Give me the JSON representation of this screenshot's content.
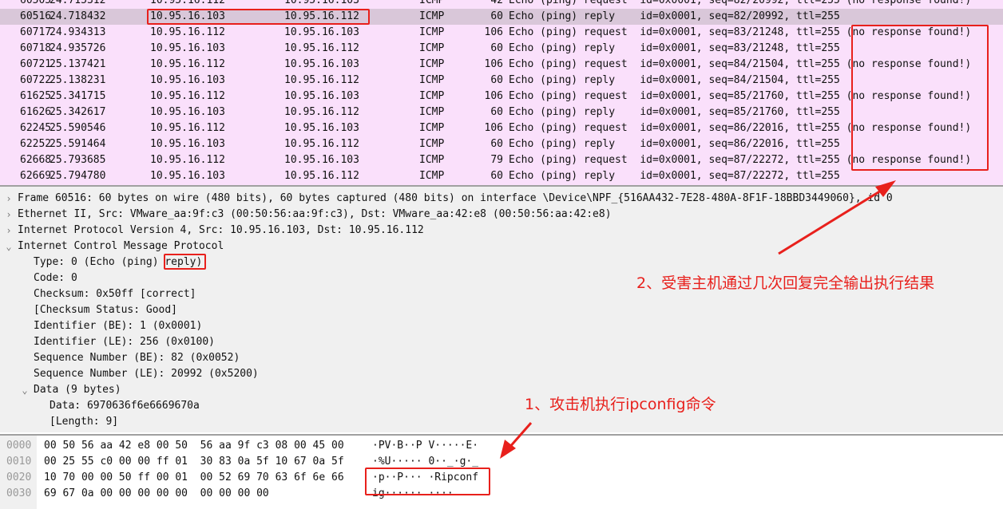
{
  "packets": [
    {
      "no": "60505",
      "time": "24.715312",
      "src": "10.95.16.112",
      "dst": "10.95.16.103",
      "proto": "ICMP",
      "len": "42",
      "info": "Echo (ping) request  id=0x0001, seq=82/20992, ttl=255 (no response found!)"
    },
    {
      "no": "60516",
      "time": "24.718432",
      "src": "10.95.16.103",
      "dst": "10.95.16.112",
      "proto": "ICMP",
      "len": "60",
      "info": "Echo (ping) reply    id=0x0001, seq=82/20992, ttl=255"
    },
    {
      "no": "60717",
      "time": "24.934313",
      "src": "10.95.16.112",
      "dst": "10.95.16.103",
      "proto": "ICMP",
      "len": "106",
      "info": "Echo (ping) request  id=0x0001, seq=83/21248, ttl=255 (no response found!)"
    },
    {
      "no": "60718",
      "time": "24.935726",
      "src": "10.95.16.103",
      "dst": "10.95.16.112",
      "proto": "ICMP",
      "len": "60",
      "info": "Echo (ping) reply    id=0x0001, seq=83/21248, ttl=255"
    },
    {
      "no": "60721",
      "time": "25.137421",
      "src": "10.95.16.112",
      "dst": "10.95.16.103",
      "proto": "ICMP",
      "len": "106",
      "info": "Echo (ping) request  id=0x0001, seq=84/21504, ttl=255 (no response found!)"
    },
    {
      "no": "60722",
      "time": "25.138231",
      "src": "10.95.16.103",
      "dst": "10.95.16.112",
      "proto": "ICMP",
      "len": "60",
      "info": "Echo (ping) reply    id=0x0001, seq=84/21504, ttl=255"
    },
    {
      "no": "61625",
      "time": "25.341715",
      "src": "10.95.16.112",
      "dst": "10.95.16.103",
      "proto": "ICMP",
      "len": "106",
      "info": "Echo (ping) request  id=0x0001, seq=85/21760, ttl=255 (no response found!)"
    },
    {
      "no": "61626",
      "time": "25.342617",
      "src": "10.95.16.103",
      "dst": "10.95.16.112",
      "proto": "ICMP",
      "len": "60",
      "info": "Echo (ping) reply    id=0x0001, seq=85/21760, ttl=255"
    },
    {
      "no": "62245",
      "time": "25.590546",
      "src": "10.95.16.112",
      "dst": "10.95.16.103",
      "proto": "ICMP",
      "len": "106",
      "info": "Echo (ping) request  id=0x0001, seq=86/22016, ttl=255 (no response found!)"
    },
    {
      "no": "62252",
      "time": "25.591464",
      "src": "10.95.16.103",
      "dst": "10.95.16.112",
      "proto": "ICMP",
      "len": "60",
      "info": "Echo (ping) reply    id=0x0001, seq=86/22016, ttl=255"
    },
    {
      "no": "62668",
      "time": "25.793685",
      "src": "10.95.16.112",
      "dst": "10.95.16.103",
      "proto": "ICMP",
      "len": "79",
      "info": "Echo (ping) request  id=0x0001, seq=87/22272, ttl=255 (no response found!)"
    },
    {
      "no": "62669",
      "time": "25.794780",
      "src": "10.95.16.103",
      "dst": "10.95.16.112",
      "proto": "ICMP",
      "len": "60",
      "info": "Echo (ping) reply    id=0x0001, seq=87/22272, ttl=255"
    }
  ],
  "selected_packet": "60516",
  "details": [
    {
      "indent": 0,
      "toggle": ">",
      "text": "Frame 60516: 60 bytes on wire (480 bits), 60 bytes captured (480 bits) on interface \\Device\\NPF_{516AA432-7E28-480A-8F1F-18BBD3449060}, id 0"
    },
    {
      "indent": 0,
      "toggle": ">",
      "text": "Ethernet II, Src: VMware_aa:9f:c3 (00:50:56:aa:9f:c3), Dst: VMware_aa:42:e8 (00:50:56:aa:42:e8)"
    },
    {
      "indent": 0,
      "toggle": ">",
      "text": "Internet Protocol Version 4, Src: 10.95.16.103, Dst: 10.95.16.112"
    },
    {
      "indent": 0,
      "toggle": "v",
      "text": "Internet Control Message Protocol"
    },
    {
      "indent": 1,
      "toggle": "",
      "text": "Type: 0 (Echo (ping) reply)"
    },
    {
      "indent": 1,
      "toggle": "",
      "text": "Code: 0"
    },
    {
      "indent": 1,
      "toggle": "",
      "text": "Checksum: 0x50ff [correct]"
    },
    {
      "indent": 1,
      "toggle": "",
      "text": "[Checksum Status: Good]"
    },
    {
      "indent": 1,
      "toggle": "",
      "text": "Identifier (BE): 1 (0x0001)"
    },
    {
      "indent": 1,
      "toggle": "",
      "text": "Identifier (LE): 256 (0x0100)"
    },
    {
      "indent": 1,
      "toggle": "",
      "text": "Sequence Number (BE): 82 (0x0052)"
    },
    {
      "indent": 1,
      "toggle": "",
      "text": "Sequence Number (LE): 20992 (0x5200)"
    },
    {
      "indent": 1,
      "toggle": "v",
      "text": "Data (9 bytes)"
    },
    {
      "indent": 2,
      "toggle": "",
      "text": "Data: 6970636f6e6669670a"
    },
    {
      "indent": 2,
      "toggle": "",
      "text": "[Length: 9]"
    }
  ],
  "hex": [
    {
      "off": "0000",
      "hex": "00 50 56 aa 42 e8 00 50  56 aa 9f c3 08 00 45 00",
      "ascii": "·PV·B··P V·····E·"
    },
    {
      "off": "0010",
      "hex": "00 25 55 c0 00 00 ff 01  30 83 0a 5f 10 67 0a 5f",
      "ascii": "·%U····· 0··_·g·_"
    },
    {
      "off": "0020",
      "hex": "10 70 00 00 50 ff 00 01  00 52 69 70 63 6f 6e 66",
      "ascii": "·p··P··· ·Ripconf"
    },
    {
      "off": "0030",
      "hex": "69 67 0a 00 00 00 00 00  00 00 00 00",
      "ascii": "ig······ ····"
    }
  ],
  "annotations": {
    "note2": "2、受害主机通过几次回复完全输出执行结果",
    "note1": "1、攻击机执行ipconfig命令",
    "color": "#e8201c"
  },
  "colors": {
    "list_bg": "#fae0fb",
    "selected_bg": "#d9c7d9",
    "pane_bg": "#f0f0f0"
  }
}
